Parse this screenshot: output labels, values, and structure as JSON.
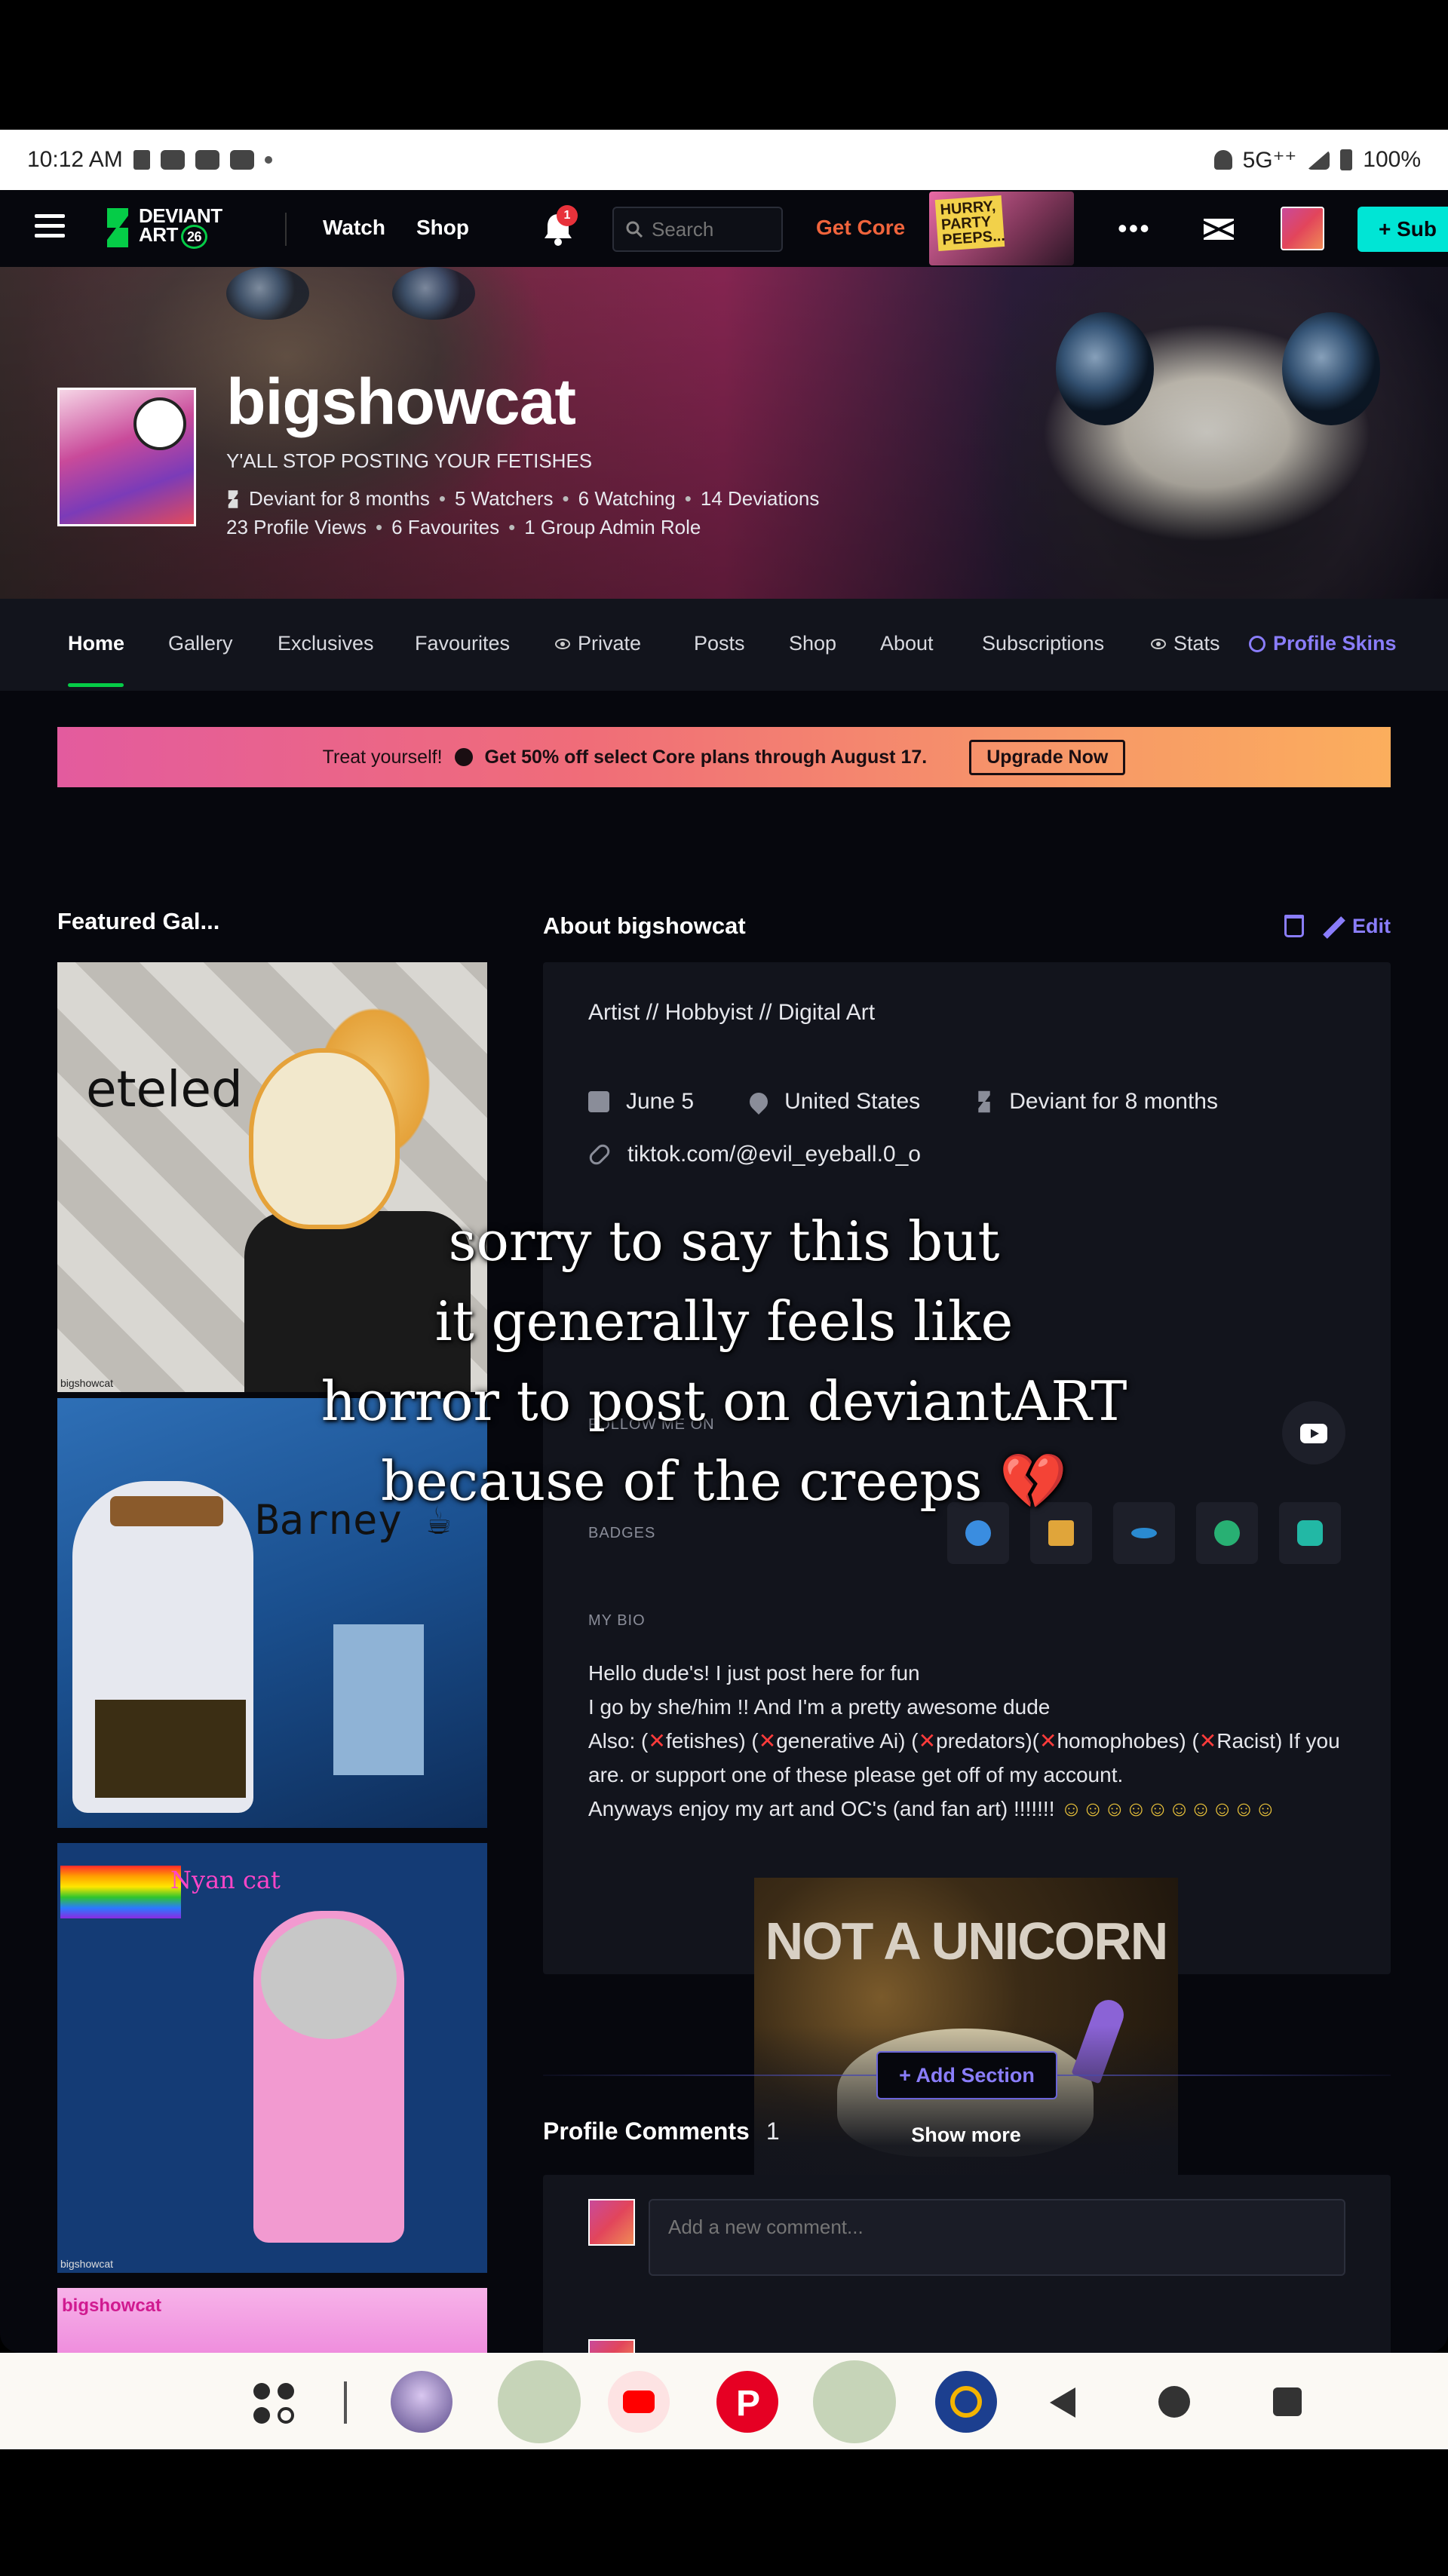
{
  "status_bar": {
    "time": "10:12 AM",
    "network": "5G⁺⁺",
    "battery": "100%"
  },
  "nav": {
    "logo_line1": "DEVIANT",
    "logo_line2": "ART",
    "logo_badge": "26",
    "watch": "Watch",
    "shop": "Shop",
    "notif_count": "1",
    "search_placeholder": "Search",
    "get_core": "Get Core",
    "promo_badge": "HURRY, PARTY PEEPS...",
    "more": "•••",
    "submit": "+ Sub"
  },
  "profile": {
    "username": "bigshowcat",
    "tagline": "Y'ALL STOP POSTING YOUR FETISHES",
    "stats1": [
      "Deviant for 8 months",
      "5 Watchers",
      "6 Watching",
      "14 Deviations"
    ],
    "stats2": [
      "23 Profile Views",
      "6 Favourites",
      "1 Group Admin Role"
    ]
  },
  "tabs": [
    "Home",
    "Gallery",
    "Exclusives",
    "Favourites",
    "Private",
    "Posts",
    "Shop",
    "About",
    "Subscriptions",
    "Stats",
    "Profile Skins"
  ],
  "promo": {
    "lead": "Treat yourself!",
    "offer": "Get 50% off select Core plans through August 17.",
    "button": "Upgrade Now"
  },
  "featured": {
    "title": "Featured Gal...",
    "items": [
      {
        "text": "eteled",
        "signature": "bigshowcat"
      },
      {
        "text": "Barney ☕"
      },
      {
        "text": "Nyan cat",
        "signature": "bigshowcat"
      },
      {
        "text": "bigshowcat"
      }
    ]
  },
  "about": {
    "title": "About bigshowcat",
    "edit": "Edit",
    "roles": "Artist  //  Hobbyist  //  Digital Art",
    "birthday": "June 5",
    "location": "United States",
    "deviant_for": "Deviant for 8 months",
    "link": "tiktok.com/@evil_eyeball.0_o",
    "follow_label": "FOLLOW ME ON",
    "badges_label": "BADGES",
    "bio_label": "MY BIO",
    "bio_line1": "Hello dude's! I just post here for fun",
    "bio_line2": "I go by she/him !! And I'm a pretty awesome dude",
    "bio_also": "Also:",
    "bio_fetishes": "fetishes)",
    "bio_ai": "generative Ai)",
    "bio_predators": "predators)",
    "bio_homophobes": "homophobes)",
    "bio_racist": "Racist) If you are. or support one of these please get off of my account.",
    "bio_line4": "Anyways enjoy my art and OC's (and fan art) !!!!!!!",
    "smileys": "☺☺☺☺☺☺☺☺☺☺",
    "image_text": "NOT A UNICORN",
    "show_more": "Show more"
  },
  "add_section": "+ Add Section",
  "comments": {
    "title": "Profile Comments",
    "count": "1",
    "placeholder": "Add a new comment..."
  },
  "caption": {
    "line1": "sorry to say this but",
    "line2": "it generally feels like",
    "line3": "horror to post on deviantART",
    "line4": "because of the creeps",
    "heart": "💔"
  }
}
